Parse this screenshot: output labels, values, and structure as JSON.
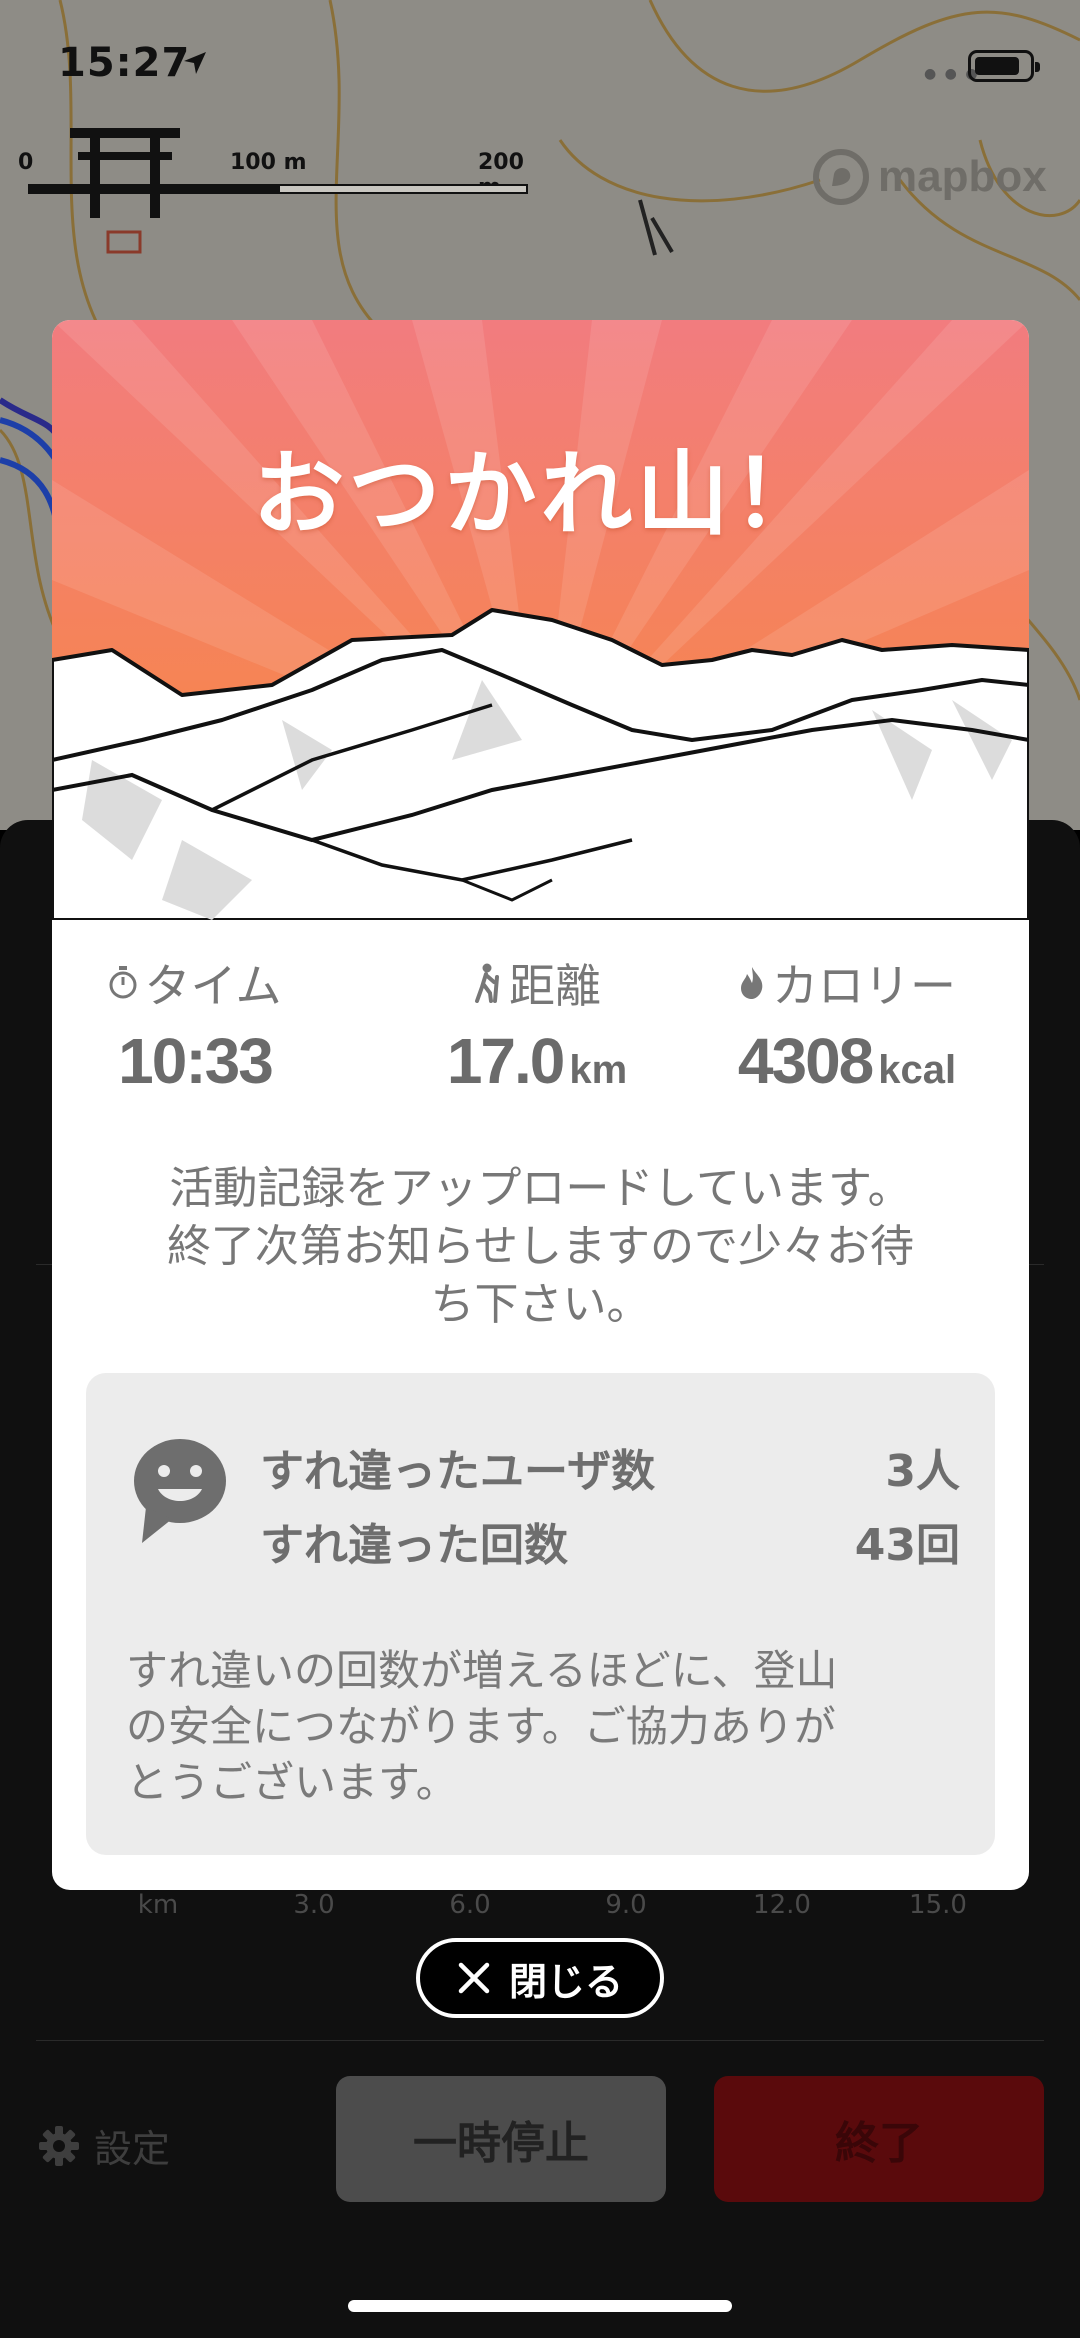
{
  "status_bar": {
    "time": "15:27"
  },
  "map": {
    "scale_labels": [
      "0",
      "100 m",
      "200 m"
    ],
    "attribution": "mapbox"
  },
  "modal": {
    "headline": "おつかれ山！",
    "stats": [
      {
        "icon": "stopwatch-icon",
        "label": "タイム",
        "value": "10:33",
        "unit": ""
      },
      {
        "icon": "hiker-icon",
        "label": "距離",
        "value": "17.0",
        "unit": "km"
      },
      {
        "icon": "flame-icon",
        "label": "カロリー",
        "value": "4308",
        "unit": "kcal"
      }
    ],
    "upload_message_lines": [
      "活動記録をアップロードしています。",
      "終了次第お知らせしますので少々お待",
      "ち下さい。"
    ],
    "passing": {
      "users_label": "すれ違ったユーザ数",
      "users_value": "3人",
      "count_label": "すれ違った回数",
      "count_value": "43回",
      "note_lines": [
        "すれ違いの回数が増えるほどに、登山",
        "の安全につながります。ご協力ありが",
        "とうございます。"
      ]
    }
  },
  "close_button": {
    "label": "閉じる"
  },
  "chart_axis": {
    "labels": [
      "km",
      "3.0",
      "6.0",
      "9.0",
      "12.0",
      "15.0"
    ]
  },
  "bottom_bar": {
    "settings_label": "設定",
    "pause_label": "一時停止",
    "end_label": "終了"
  },
  "colors": {
    "header_top": "#f2797a",
    "header_bottom": "#f78a3c",
    "end_button": "#5a0a0c",
    "pause_button": "#4c4c4c"
  }
}
